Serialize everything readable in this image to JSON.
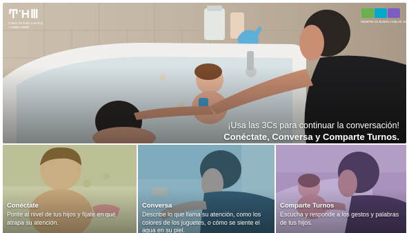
{
  "logo_left": {
    "mark": "ͲΉⅢ",
    "subtitle_line1": "Center for Early Learning",
    "subtitle_line2": "+ Public Health"
  },
  "logo_right": {
    "tagline": "SIEMPRE ES BUENO HABLAR JUNTOS",
    "badge_colors": [
      "#6ab04c",
      "#00a8cc",
      "#7d5cc4"
    ]
  },
  "hero": {
    "line1": "¡Usa las 3Cs para continuar la conversación!",
    "line2": "Conéctate, Conversa y Comparte Turnos."
  },
  "panels": [
    {
      "title": "Conéctate",
      "body": "Ponte al nivel de tus hijos y fíjate en qué atrapa su atención.",
      "tint": "#8fb050"
    },
    {
      "title": "Conversa",
      "body": "Describe lo que llama su atención, como los colores de los juguetes, o cómo se siente el agua en su piel.",
      "tint": "#3c8caf"
    },
    {
      "title": "Comparte Turnos",
      "body": "Escucha y responde a los gestos y palabras de tus hijos.",
      "tint": "#7d5aaf"
    }
  ]
}
